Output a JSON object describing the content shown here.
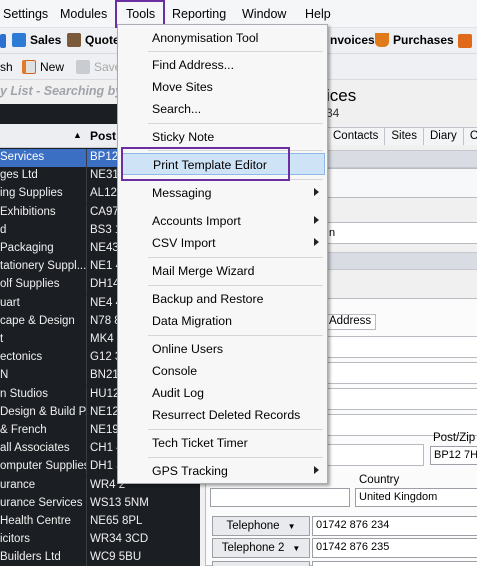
{
  "menubar": {
    "items": [
      "Settings",
      "Modules",
      "Tools",
      "Reporting",
      "Window",
      "Help"
    ]
  },
  "toolbar1": {
    "sales": "Sales",
    "quotes": "Quote",
    "invoices": "nvoices",
    "purchases": "Purchases"
  },
  "toolbar2": {
    "refresh": "sh",
    "new": "New",
    "save": "Save"
  },
  "list": {
    "title": "y List - Searching by",
    "col_post": "Post",
    "rows": [
      {
        "name": " Services",
        "post": "BP12"
      },
      {
        "name": "ges Ltd",
        "post": "NE31"
      },
      {
        "name": "ing Supplies",
        "post": "AL12"
      },
      {
        "name": "Exhibitions",
        "post": "CA97"
      },
      {
        "name": "d",
        "post": "BS3 1"
      },
      {
        "name": "Packaging",
        "post": "NE43"
      },
      {
        "name": "tationery Suppl...",
        "post": "NE1 4"
      },
      {
        "name": "olf Supplies",
        "post": "DH14"
      },
      {
        "name": "uart",
        "post": "NE4 4"
      },
      {
        "name": "cape & Design",
        "post": "N78 8"
      },
      {
        "name": "t",
        "post": "MK4 3"
      },
      {
        "name": "ectonics",
        "post": "G12 3"
      },
      {
        "name": "N",
        "post": "BN21"
      },
      {
        "name": "n Studios",
        "post": "HU12"
      },
      {
        "name": "Design & Build P...",
        "post": "NE12"
      },
      {
        "name": "& French",
        "post": "NE19"
      },
      {
        "name": "all Associates",
        "post": "CH1 4"
      },
      {
        "name": "omputer Supplies",
        "post": "DH1 3"
      },
      {
        "name": "urance",
        "post": "WR4 2"
      },
      {
        "name": "urance Services",
        "post": "WS13 5NM"
      },
      {
        "name": "Health Centre",
        "post": "NE65 8PL"
      },
      {
        "name": "icitors",
        "post": "WR34 3CD"
      },
      {
        "name": " Builders Ltd",
        "post": "WC9 5BU"
      }
    ]
  },
  "detail": {
    "title": "ices",
    "subtitle": "34",
    "tabs": [
      "Contacts",
      "Sites",
      "Diary",
      "C"
    ],
    "field_fragment": "n",
    "address_tab": "Address",
    "postzip_label": "Post/Zip C",
    "postzip_value": "BP12 7HT",
    "country_label": "Country",
    "country_value": "United Kingdom",
    "phone1_label": "Telephone",
    "phone1_value": "01742 876 234",
    "phone2_label": "Telephone 2",
    "phone2_value": "01742 876 235"
  },
  "tools_menu": {
    "items": [
      {
        "label": "Anonymisation Tool",
        "submenu": false
      },
      {
        "label": "Find Address...",
        "submenu": false
      },
      {
        "label": "Move Sites",
        "submenu": false
      },
      {
        "label": "Search...",
        "submenu": false
      },
      {
        "label": "Sticky Note",
        "submenu": false
      },
      {
        "label": "Print Template Editor",
        "submenu": false,
        "highlighted": true
      },
      {
        "label": "Messaging",
        "submenu": true
      },
      {
        "label": "Accounts Import",
        "submenu": true
      },
      {
        "label": "CSV Import",
        "submenu": true
      },
      {
        "label": "Mail Merge Wizard",
        "submenu": false
      },
      {
        "label": "Backup and Restore",
        "submenu": false
      },
      {
        "label": "Data Migration",
        "submenu": false
      },
      {
        "label": "Online Users",
        "submenu": false
      },
      {
        "label": "Console",
        "submenu": false
      },
      {
        "label": "Audit Log",
        "submenu": false
      },
      {
        "label": "Resurrect Deleted Records",
        "submenu": false
      },
      {
        "label": "Tech Ticket Timer",
        "submenu": false
      },
      {
        "label": "GPS Tracking",
        "submenu": true
      }
    ]
  },
  "colors": {
    "accent_highlight": "#6b2fa3",
    "menu_hover": "#cfe3f7",
    "list_background": "#1b1e23",
    "list_selected": "#3a6fc4"
  }
}
